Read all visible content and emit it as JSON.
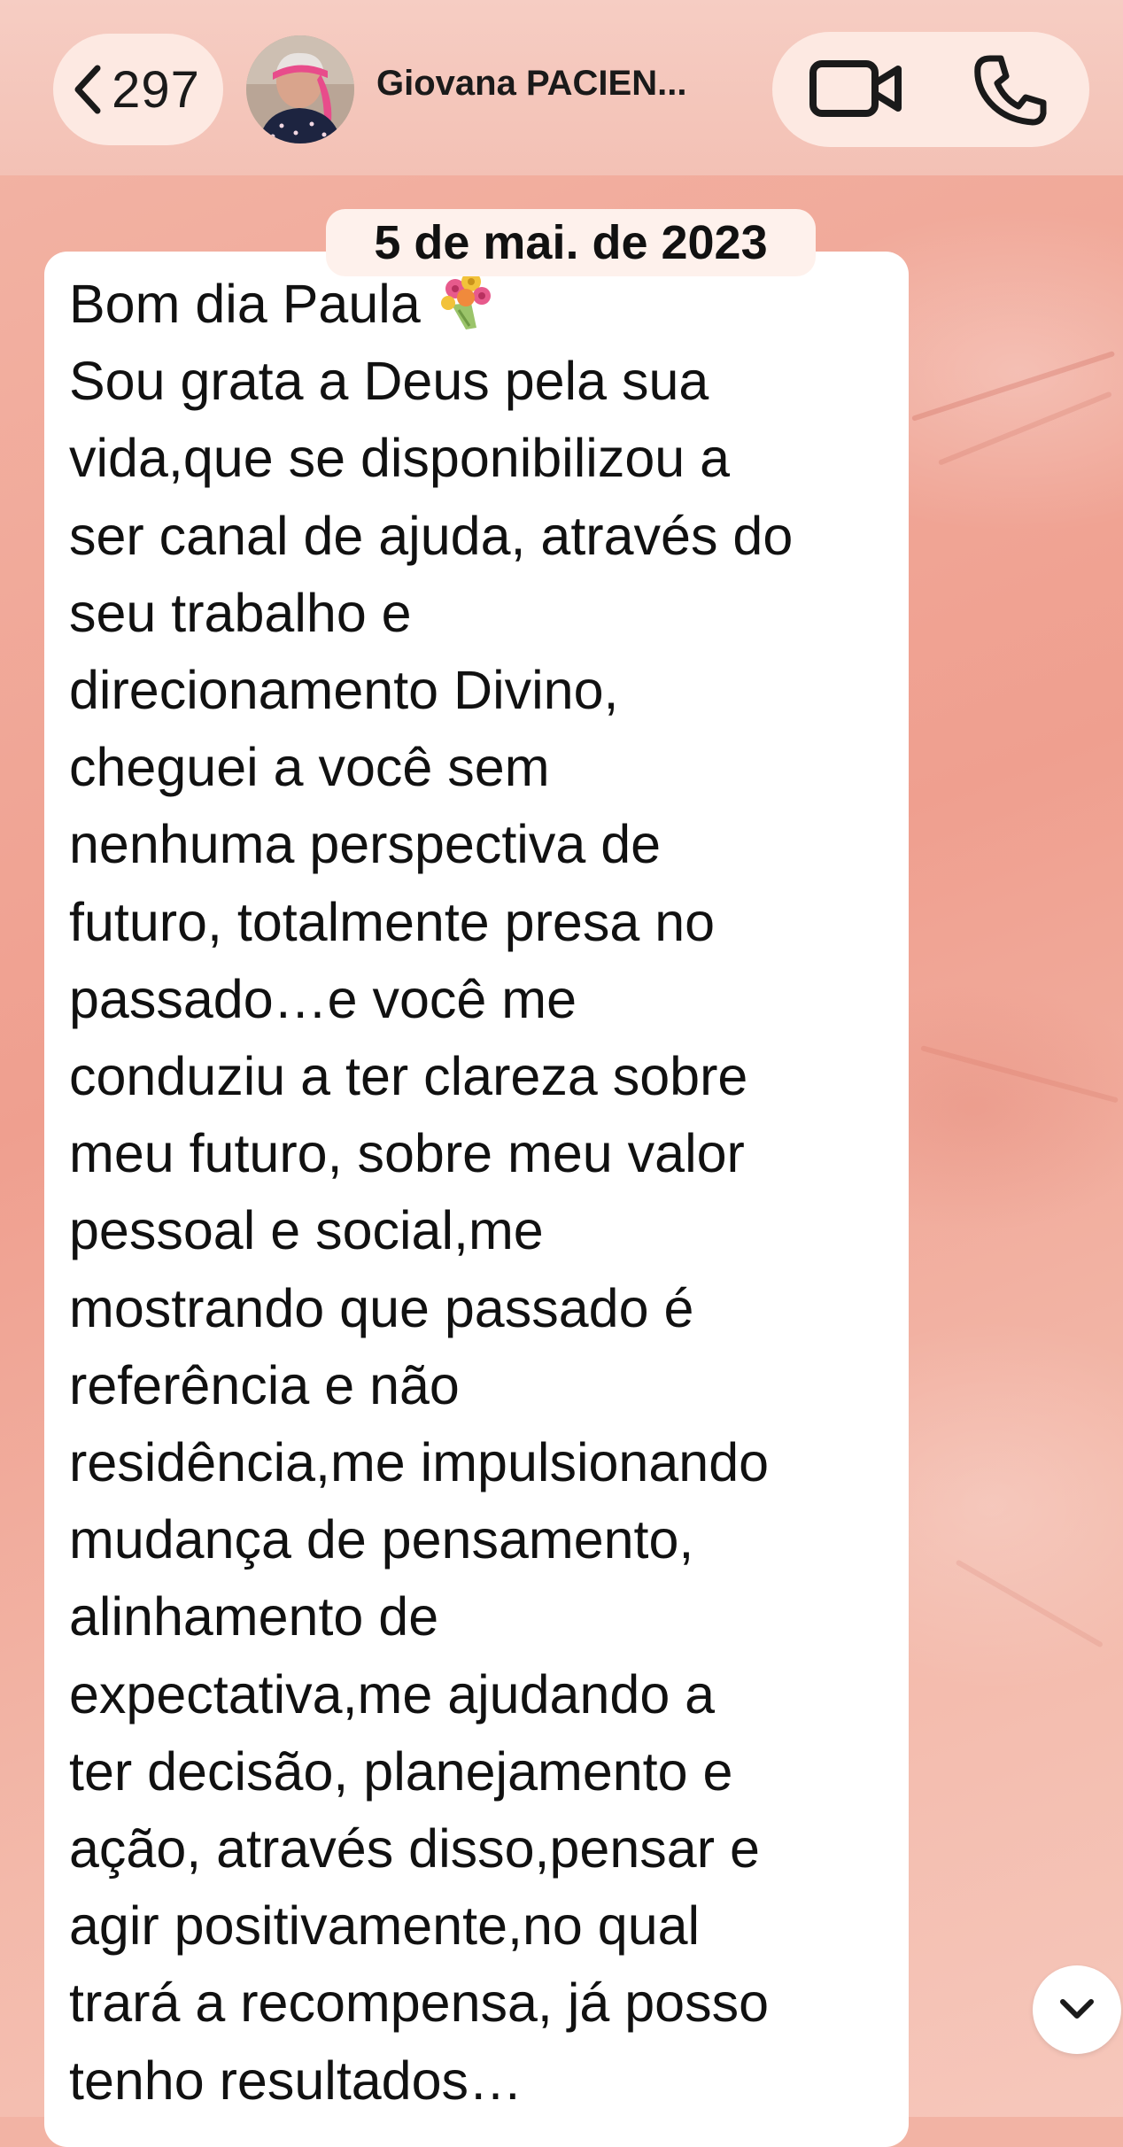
{
  "header": {
    "back_count": "297",
    "contact_name": "Giovana PACIEN...",
    "icons": {
      "back": "chevron-left-icon",
      "video": "video-camera-icon",
      "phone": "phone-icon",
      "avatar": "contact-avatar"
    }
  },
  "date_separator": "5 de mai. de 2023",
  "message": {
    "greeting": "Bom dia Paula ",
    "emoji": "bouquet-emoji",
    "body": "Sou grata a Deus pela sua\nvida,que se disponibilizou a\nser canal de ajuda, através do\nseu trabalho e\ndirecionamento Divino,\ncheguei a você sem\nnenhuma perspectiva de\nfuturo, totalmente presa no\npassado…e você me\nconduziu a ter clareza sobre\nmeu futuro, sobre meu valor\npessoal e social,me\nmostrando que passado é\nreferência e não\nresidência,me impulsionando\nmudança de pensamento,\nalinhamento de\nexpectativa,me ajudando a\nter decisão, planejamento e\nação, através disso,pensar e\nagir positivamente,no qual\ntrará a recompensa, já posso\ntenho resultados…"
  },
  "scroll_button": {
    "icon": "chevron-down-icon"
  },
  "colors": {
    "header_bg": "#f3c1b5",
    "pill_bg": "#fde9e2",
    "chat_bg": "#ef9f8f",
    "bubble_bg": "#ffffff",
    "text": "#111111"
  }
}
